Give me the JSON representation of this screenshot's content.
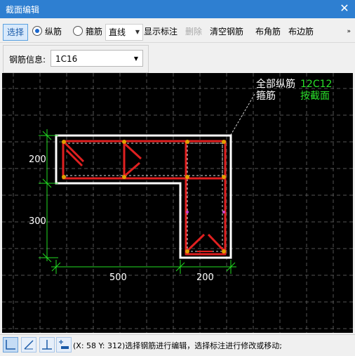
{
  "window": {
    "title": "截面编辑",
    "close_icon": "close-icon"
  },
  "toolbar": {
    "select_label": "选择",
    "longitudinal_label": "纵筋",
    "stirrup_label": "箍筋",
    "draw_mode_value": "直线",
    "show_annotation_label": "显示标注",
    "delete_label": "删除",
    "clear_rebar_label": "清空钢筋",
    "corner_rebar_label": "布角筋",
    "edge_rebar_label": "布边筋",
    "more_icon": "»"
  },
  "rebar_info": {
    "label": "钢筋信息:",
    "value": "1C16"
  },
  "canvas": {
    "all_longitudinal_label": "全部纵筋",
    "all_longitudinal_value": "12C12",
    "stirrup_label": "箍筋",
    "stirrup_value": "按截面",
    "dim_200_left": "200",
    "dim_300_left": "300",
    "dim_500_bottom": "500",
    "dim_200_bottom": "200",
    "colors": {
      "background": "#000000",
      "outline": "#ffffff",
      "rebar": "#e02020",
      "dimension": "#22dd22",
      "grid": "#505050"
    }
  },
  "statusbar": {
    "tools": [
      "ortho-icon",
      "polar-icon",
      "osnap-icon",
      "dynamic-input-icon"
    ],
    "message": "(X: 58 Y: 312)选择钢筋进行编辑，选择标注进行修改或移动;"
  }
}
